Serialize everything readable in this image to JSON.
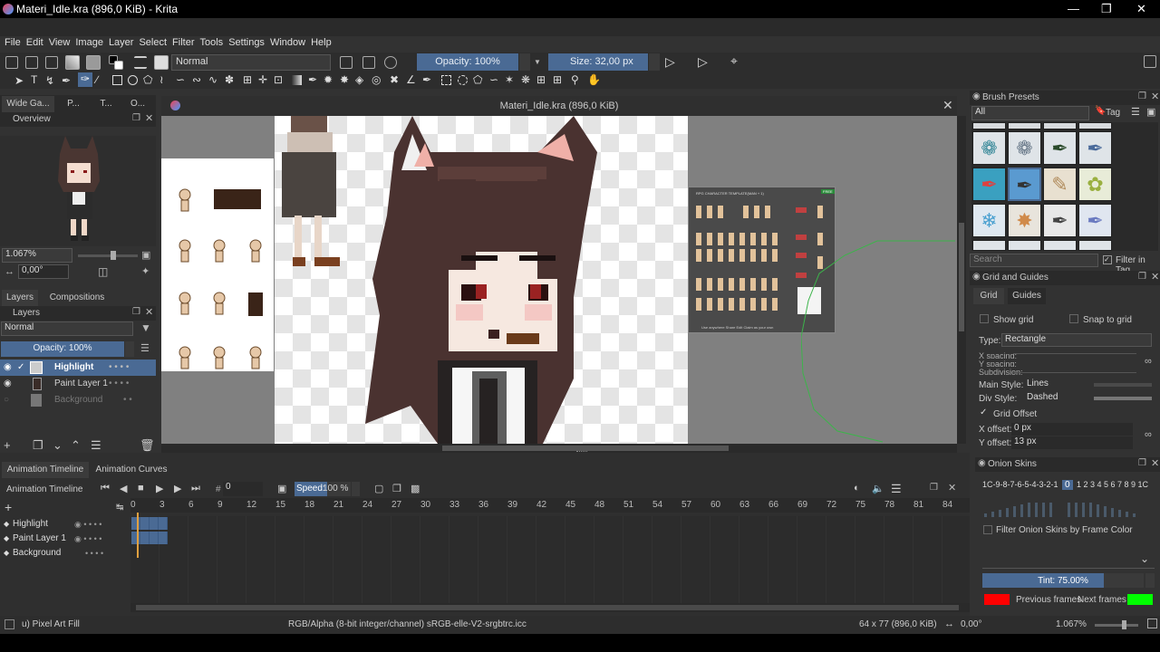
{
  "window": {
    "title": "Materi_Idle.kra (896,0 KiB)  - Krita"
  },
  "menu": [
    "File",
    "Edit",
    "View",
    "Image",
    "Layer",
    "Select",
    "Filter",
    "Tools",
    "Settings",
    "Window",
    "Help"
  ],
  "toolbar": {
    "blend_mode": "Normal",
    "opacity": "Opacity: 100%",
    "size": "Size: 32,00 px"
  },
  "left_tabs": [
    "Wide Ga...",
    "P...",
    "T...",
    "O..."
  ],
  "overview": {
    "title": "Overview",
    "zoom": "1.067%",
    "rotation": "0,00°"
  },
  "layers_tabs": [
    "Layers",
    "Compositions"
  ],
  "layers": {
    "title": "Layers",
    "blend": "Normal",
    "opacity": "Opacity:  100%",
    "items": [
      {
        "name": "Highlight"
      },
      {
        "name": "Paint Layer 1"
      },
      {
        "name": "Background"
      }
    ]
  },
  "document": {
    "title": "Materi_Idle.kra (896,0 KiB)"
  },
  "template_sheet": {
    "title": "RPG CHARACTER TEMPLATE(MAN + 1)",
    "badge": "FREE",
    "footer": "Use anywhere   Share   Edit   Claim as your own"
  },
  "brush_presets": {
    "title": "Brush Presets",
    "filter": "All",
    "tag": "Tag",
    "search_placeholder": "Search",
    "filter_in_tag": "Filter in Tag"
  },
  "grid": {
    "title": "Grid and Guides",
    "tabs": [
      "Grid",
      "Guides"
    ],
    "show_grid": "Show grid",
    "snap_to_grid": "Snap to grid",
    "type_label": "Type:",
    "type_value": "Rectangle",
    "x_spacing": "X spacing:",
    "y_spacing": "Y spacing:",
    "subdivision": "Subdivision:",
    "main_style_label": "Main Style:",
    "main_style": "Lines",
    "div_style_label": "Div Style:",
    "div_style": "Dashed",
    "grid_offset": "Grid Offset",
    "x_offset_label": "X offset:",
    "x_offset": "0 px",
    "y_offset_label": "Y offset:",
    "y_offset": "13 px"
  },
  "onion": {
    "title": "Onion Skins",
    "scale": "1C-9-8-7-6-5-4-3-2-1",
    "current": "0",
    "after": "1 2 3 4 5 6 7 8 9 1C",
    "filter": "Filter Onion Skins by Frame Color",
    "tint": "Tint: 75.00%",
    "prev": "Previous frames",
    "next": "Next frames",
    "prev_color": "#ff0000",
    "next_color": "#00ff00"
  },
  "timeline_tabs": [
    "Animation Timeline",
    "Animation Curves"
  ],
  "timeline": {
    "title": "Animation Timeline",
    "frame": "0",
    "speed_label": "Speed:",
    "speed": "100 %",
    "layers": [
      "Highlight",
      "Paint Layer 1",
      "Background"
    ],
    "frames": [
      "0",
      "3",
      "6",
      "9",
      "12",
      "15",
      "18",
      "21",
      "24",
      "27",
      "30",
      "33",
      "36",
      "39",
      "42",
      "45",
      "48",
      "51",
      "54",
      "57",
      "60",
      "63",
      "66",
      "69",
      "72",
      "75",
      "78",
      "81",
      "84"
    ]
  },
  "status": {
    "brush": "u) Pixel Art Fill",
    "color_space": "RGB/Alpha (8-bit integer/channel)  sRGB-elle-V2-srgbtrc.icc",
    "dims": "64 x 77 (896,0 KiB)",
    "rotation": "0,00°",
    "zoom": "1.067%"
  }
}
